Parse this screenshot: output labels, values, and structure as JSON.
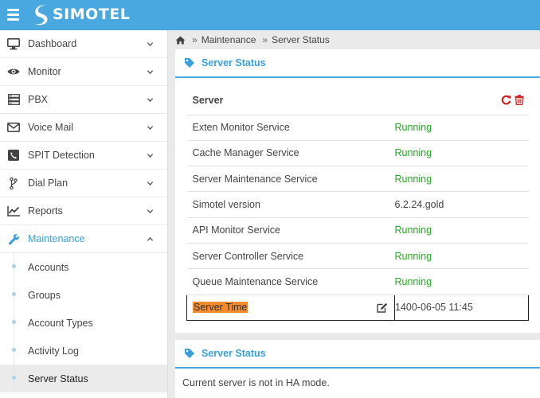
{
  "app": {
    "logo_text": "SIMOTEL"
  },
  "sidebar": {
    "items": [
      {
        "label": "Dashboard",
        "icon": "monitor-icon"
      },
      {
        "label": "Monitor",
        "icon": "eye-icon"
      },
      {
        "label": "PBX",
        "icon": "server-icon"
      },
      {
        "label": "Voice Mail",
        "icon": "envelope-icon"
      },
      {
        "label": "SPIT Detection",
        "icon": "phone-square-icon"
      },
      {
        "label": "Dial Plan",
        "icon": "branch-icon"
      },
      {
        "label": "Reports",
        "icon": "line-chart-icon"
      },
      {
        "label": "Maintenance",
        "icon": "wrench-icon"
      }
    ],
    "subitems": [
      {
        "label": "Accounts"
      },
      {
        "label": "Groups"
      },
      {
        "label": "Account Types"
      },
      {
        "label": "Activity Log"
      },
      {
        "label": "Server Status"
      }
    ]
  },
  "breadcrumb": {
    "sep": "»",
    "section": "Maintenance",
    "page": "Server Status"
  },
  "panel1": {
    "title": "Server Status",
    "header": "Server",
    "rows": [
      {
        "name": "Exten Monitor Service",
        "value": "Running"
      },
      {
        "name": "Cache Manager Service",
        "value": "Running"
      },
      {
        "name": "Server Maintenance Service",
        "value": "Running"
      },
      {
        "name": "Simotel version",
        "value": "6.2.24.gold"
      },
      {
        "name": "API Monitor Service",
        "value": "Running"
      },
      {
        "name": "Server Controller Service",
        "value": "Running"
      },
      {
        "name": "Queue Maintenance Service",
        "value": "Running"
      },
      {
        "name": "Server Time",
        "value": "1400-06-05 11:45"
      }
    ]
  },
  "panel2": {
    "title": "Server Status",
    "note": "Current server is not in HA mode."
  },
  "colors": {
    "accent": "#4aa8e0",
    "running": "#22aa22",
    "danger": "#cc2222",
    "highlight": "#f28a2e"
  }
}
